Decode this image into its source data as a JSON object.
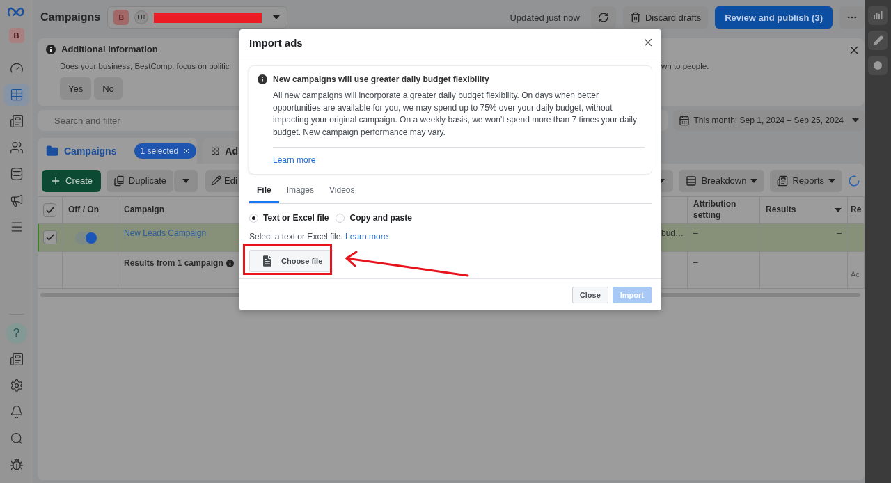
{
  "sidebar": {
    "avatar": "B",
    "nav": [
      {
        "kind": "gauge",
        "selected": false
      },
      {
        "kind": "table",
        "selected": true
      },
      {
        "kind": "pages",
        "selected": false
      },
      {
        "kind": "people",
        "selected": false
      },
      {
        "kind": "coins",
        "selected": false
      },
      {
        "kind": "megaphone",
        "selected": false
      },
      {
        "kind": "menu",
        "selected": false
      }
    ],
    "bottom": [
      {
        "kind": "help",
        "label": "?"
      },
      {
        "kind": "news"
      },
      {
        "kind": "settings"
      },
      {
        "kind": "bell"
      },
      {
        "kind": "search"
      },
      {
        "kind": "bug"
      }
    ]
  },
  "header": {
    "title": "Campaigns",
    "account": {
      "avatar": "B",
      "name_redacted": true
    },
    "status": "Updated just now",
    "buttons": [
      {
        "kind": "refresh"
      },
      {
        "kind": "discard",
        "label": "Discard drafts"
      },
      {
        "kind": "publish",
        "label": "Review and publish (3)"
      },
      {
        "kind": "more"
      }
    ]
  },
  "notice": {
    "title": "Additional information",
    "text_start": "Does your business, BestComp, focus on politic",
    "text_end": "wn to people.",
    "buttons": [
      "Yes",
      "No"
    ]
  },
  "filter": {
    "search_placeholder": "Search and filter",
    "date_range": "This month: Sep 1, 2024 – Sep 25, 2024"
  },
  "level_tabs": [
    {
      "label": "Campaigns",
      "selected": true,
      "badge": "1 selected"
    },
    {
      "label": "Ad",
      "selected": false
    }
  ],
  "toolbar": {
    "left": [
      {
        "kind": "create",
        "label": "Create"
      },
      {
        "kind": "duplicate",
        "label": "Duplicate"
      },
      {
        "kind": "dropdown"
      },
      {
        "kind": "edit",
        "label": "Edi"
      }
    ],
    "right": [
      {
        "kind": "dropdown"
      },
      {
        "kind": "breakdown",
        "label": "Breakdown"
      },
      {
        "kind": "reports",
        "label": "Reports"
      },
      {
        "kind": "spinner"
      }
    ]
  },
  "table": {
    "header": {
      "checked": true,
      "columns": [
        {
          "label": "Off / On",
          "menu": false
        },
        {
          "label": "Campaign",
          "menu": false
        },
        {
          "label": "Attribution setting",
          "menu": false
        },
        {
          "label": "Results",
          "menu": true
        },
        {
          "label": "Re",
          "menu": false
        }
      ]
    },
    "rows": [
      {
        "selected": true,
        "checked": true,
        "on": true,
        "campaign": "New Leads Campaign",
        "column_4": "bud…",
        "attribution": "–",
        "results": "–"
      }
    ],
    "summary": {
      "label": "Results from 1 campaign",
      "attribution": "–",
      "column_7": "Ac"
    }
  },
  "right_rail": [
    {
      "kind": "chart"
    },
    {
      "kind": "edit"
    },
    {
      "kind": "history"
    }
  ],
  "dialog": {
    "title": "Import ads",
    "notice": {
      "title": "New campaigns will use greater daily budget flexibility",
      "text": "All new campaigns will incorporate a greater daily budget flexibility. On days when better opportunities are available for you, we may spend up to 75% over your daily budget, without impacting your original campaign. On a weekly basis, we won’t spend more than 7 times your daily budget. New campaign performance may vary.",
      "link": "Learn more"
    },
    "tabs": [
      {
        "label": "File",
        "selected": true
      },
      {
        "label": "Images",
        "selected": false
      },
      {
        "label": "Videos",
        "selected": false
      }
    ],
    "options": [
      {
        "label": "Text or Excel file",
        "selected": true
      },
      {
        "label": "Copy and paste",
        "selected": false
      }
    ],
    "hint": "Select a text or Excel file.",
    "hint_link": "Learn more",
    "choose_button": "Choose file",
    "buttons": [
      {
        "kind": "secondary",
        "label": "Close",
        "disabled": false
      },
      {
        "kind": "primary",
        "label": "Import",
        "disabled": true
      }
    ]
  },
  "annotations": [
    {
      "kind": "box"
    },
    {
      "kind": "arrow"
    }
  ]
}
